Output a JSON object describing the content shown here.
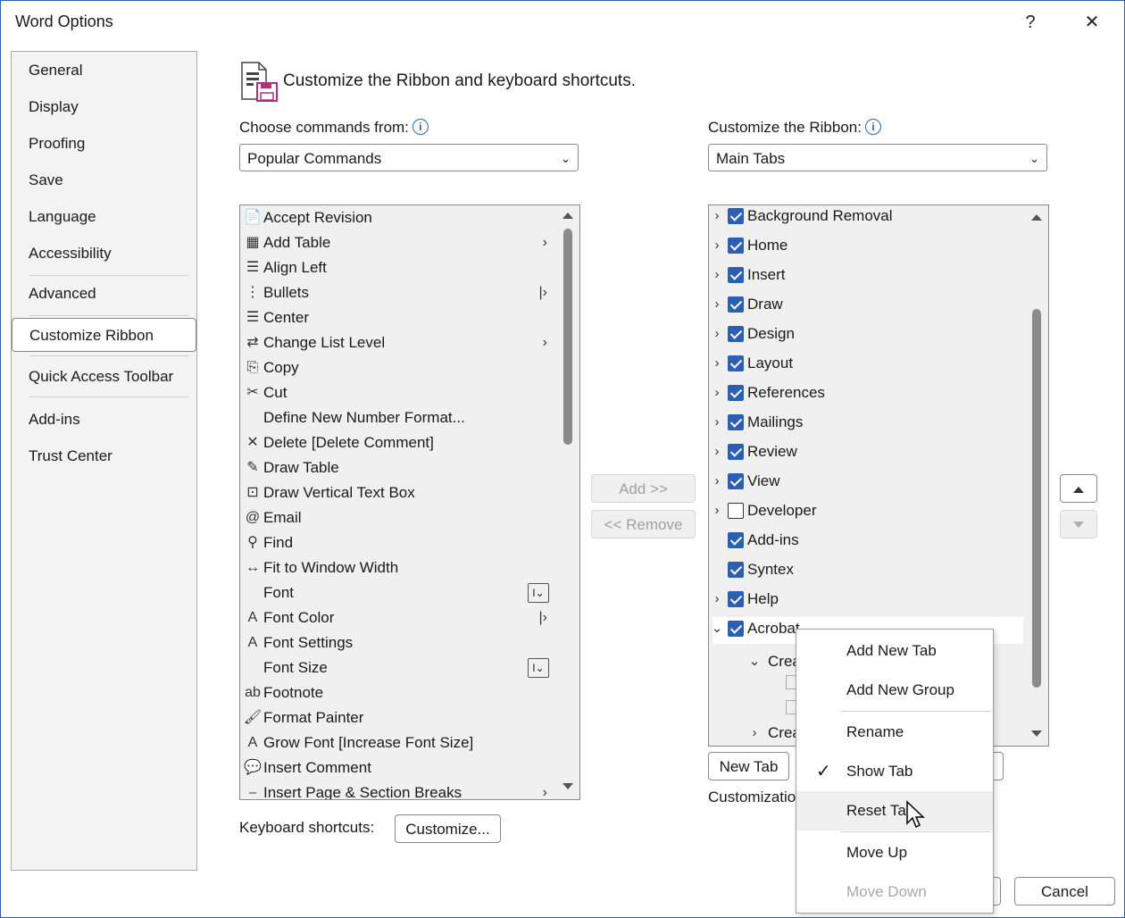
{
  "window": {
    "title": "Word Options",
    "help": "?",
    "close": "✕"
  },
  "nav": {
    "items": [
      "General",
      "Display",
      "Proofing",
      "Save",
      "Language",
      "Accessibility",
      "Advanced",
      "Customize Ribbon",
      "Quick Access Toolbar",
      "Add-ins",
      "Trust Center"
    ],
    "selected": "Customize Ribbon"
  },
  "heading": "Customize the Ribbon and keyboard shortcuts.",
  "left": {
    "label": "Choose commands from:",
    "combo_value": "Popular Commands",
    "commands": [
      {
        "label": "Accept Revision",
        "icon": "accept-revision-icon",
        "glyph": "📄",
        "sub": ""
      },
      {
        "label": "Add Table",
        "icon": "table-icon",
        "glyph": "▦",
        "sub": "›"
      },
      {
        "label": "Align Left",
        "icon": "align-left-icon",
        "glyph": "☰",
        "sub": ""
      },
      {
        "label": "Bullets",
        "icon": "bullets-icon",
        "glyph": "⋮",
        "sub": "|›"
      },
      {
        "label": "Center",
        "icon": "center-align-icon",
        "glyph": "☰",
        "sub": ""
      },
      {
        "label": "Change List Level",
        "icon": "list-level-icon",
        "glyph": "⇄",
        "sub": "›"
      },
      {
        "label": "Copy",
        "icon": "copy-icon",
        "glyph": "⎘",
        "sub": ""
      },
      {
        "label": "Cut",
        "icon": "scissors-icon",
        "glyph": "✂",
        "sub": ""
      },
      {
        "label": "Define New Number Format...",
        "icon": "",
        "glyph": "",
        "sub": ""
      },
      {
        "label": "Delete [Delete Comment]",
        "icon": "delete-comment-icon",
        "glyph": "✕",
        "sub": ""
      },
      {
        "label": "Draw Table",
        "icon": "draw-table-icon",
        "glyph": "✎",
        "sub": ""
      },
      {
        "label": "Draw Vertical Text Box",
        "icon": "text-box-icon",
        "glyph": "⊡",
        "sub": ""
      },
      {
        "label": "Email",
        "icon": "email-icon",
        "glyph": "@",
        "sub": ""
      },
      {
        "label": "Find",
        "icon": "search-icon",
        "glyph": "⚲",
        "sub": ""
      },
      {
        "label": "Fit to Window Width",
        "icon": "fit-width-icon",
        "glyph": "↔",
        "sub": ""
      },
      {
        "label": "Font",
        "icon": "",
        "glyph": "",
        "sub": "box"
      },
      {
        "label": "Font Color",
        "icon": "font-color-icon",
        "glyph": "A",
        "sub": "|›"
      },
      {
        "label": "Font Settings",
        "icon": "font-settings-icon",
        "glyph": "A",
        "sub": ""
      },
      {
        "label": "Font Size",
        "icon": "",
        "glyph": "",
        "sub": "box"
      },
      {
        "label": "Footnote",
        "icon": "footnote-icon",
        "glyph": "ab",
        "sub": ""
      },
      {
        "label": "Format Painter",
        "icon": "format-painter-icon",
        "glyph": "🖌",
        "sub": ""
      },
      {
        "label": "Grow Font [Increase Font Size]",
        "icon": "grow-font-icon",
        "glyph": "A",
        "sub": ""
      },
      {
        "label": "Insert Comment",
        "icon": "insert-comment-icon",
        "glyph": "💬",
        "sub": ""
      },
      {
        "label": "Insert Page & Section Breaks",
        "icon": "page-break-icon",
        "glyph": "⎯",
        "sub": "›"
      }
    ]
  },
  "middle": {
    "add": "Add >>",
    "remove": "<< Remove"
  },
  "right": {
    "label": "Customize the Ribbon:",
    "combo_value": "Main Tabs",
    "tabs": [
      {
        "label": "Background Removal",
        "checked": true,
        "expand": "›"
      },
      {
        "label": "Home",
        "checked": true,
        "expand": "›"
      },
      {
        "label": "Insert",
        "checked": true,
        "expand": "›"
      },
      {
        "label": "Draw",
        "checked": true,
        "expand": "›"
      },
      {
        "label": "Design",
        "checked": true,
        "expand": "›"
      },
      {
        "label": "Layout",
        "checked": true,
        "expand": "›"
      },
      {
        "label": "References",
        "checked": true,
        "expand": "›"
      },
      {
        "label": "Mailings",
        "checked": true,
        "expand": "›"
      },
      {
        "label": "Review",
        "checked": true,
        "expand": "›"
      },
      {
        "label": "View",
        "checked": true,
        "expand": "›"
      },
      {
        "label": "Developer",
        "checked": false,
        "expand": "›"
      },
      {
        "label": "Add-ins",
        "checked": true,
        "expand": ""
      },
      {
        "label": "Syntex",
        "checked": true,
        "expand": ""
      },
      {
        "label": "Help",
        "checked": true,
        "expand": "›"
      },
      {
        "label": "Acrobat",
        "checked": true,
        "expand": "⌄"
      }
    ],
    "sub_items": [
      "Crea",
      "Crea"
    ],
    "new_tab": "New Tab",
    "customizations_label": "Customizatio"
  },
  "keyboard": {
    "label": "Keyboard shortcuts:",
    "button": "Customize..."
  },
  "footer": {
    "cancel": "Cancel"
  },
  "context_menu": {
    "items": [
      {
        "label": "Add New Tab",
        "state": "normal"
      },
      {
        "label": "Add New Group",
        "state": "normal"
      },
      {
        "label": "Rename",
        "state": "normal"
      },
      {
        "label": "Show Tab",
        "state": "checked"
      },
      {
        "label": "Reset Tab",
        "state": "hover"
      },
      {
        "label": "Move Up",
        "state": "normal"
      },
      {
        "label": "Move Down",
        "state": "disabled"
      }
    ]
  },
  "colors": {
    "accent": "#2b5fb4",
    "selected_nav_border": "#888888"
  }
}
